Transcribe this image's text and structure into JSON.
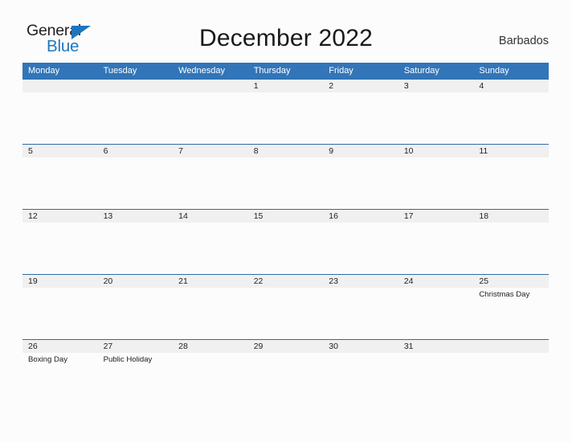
{
  "logo": {
    "word1": "General",
    "word2": "Blue",
    "triangle_icon": "triangle-flag-icon",
    "colors": {
      "dark": "#231f20",
      "blue": "#1f76bd"
    }
  },
  "header": {
    "title": "December 2022",
    "country": "Barbados"
  },
  "colors": {
    "header_blue": "#3275b8",
    "date_band_gray": "#f0f0f0",
    "rule_blue": "#2e6da4",
    "page_background": "#fcfcfc",
    "text": "#222222"
  },
  "calendar": {
    "weekday_headers": [
      "Monday",
      "Tuesday",
      "Wednesday",
      "Thursday",
      "Friday",
      "Saturday",
      "Sunday"
    ],
    "weeks": [
      [
        {
          "date": "",
          "event": ""
        },
        {
          "date": "",
          "event": ""
        },
        {
          "date": "",
          "event": ""
        },
        {
          "date": "1",
          "event": ""
        },
        {
          "date": "2",
          "event": ""
        },
        {
          "date": "3",
          "event": ""
        },
        {
          "date": "4",
          "event": ""
        }
      ],
      [
        {
          "date": "5",
          "event": ""
        },
        {
          "date": "6",
          "event": ""
        },
        {
          "date": "7",
          "event": ""
        },
        {
          "date": "8",
          "event": ""
        },
        {
          "date": "9",
          "event": ""
        },
        {
          "date": "10",
          "event": ""
        },
        {
          "date": "11",
          "event": ""
        }
      ],
      [
        {
          "date": "12",
          "event": ""
        },
        {
          "date": "13",
          "event": ""
        },
        {
          "date": "14",
          "event": ""
        },
        {
          "date": "15",
          "event": ""
        },
        {
          "date": "16",
          "event": ""
        },
        {
          "date": "17",
          "event": ""
        },
        {
          "date": "18",
          "event": ""
        }
      ],
      [
        {
          "date": "19",
          "event": ""
        },
        {
          "date": "20",
          "event": ""
        },
        {
          "date": "21",
          "event": ""
        },
        {
          "date": "22",
          "event": ""
        },
        {
          "date": "23",
          "event": ""
        },
        {
          "date": "24",
          "event": ""
        },
        {
          "date": "25",
          "event": "Christmas Day"
        }
      ],
      [
        {
          "date": "26",
          "event": "Boxing Day"
        },
        {
          "date": "27",
          "event": "Public Holiday"
        },
        {
          "date": "28",
          "event": ""
        },
        {
          "date": "29",
          "event": ""
        },
        {
          "date": "30",
          "event": ""
        },
        {
          "date": "31",
          "event": ""
        },
        {
          "date": "",
          "event": ""
        }
      ]
    ]
  }
}
